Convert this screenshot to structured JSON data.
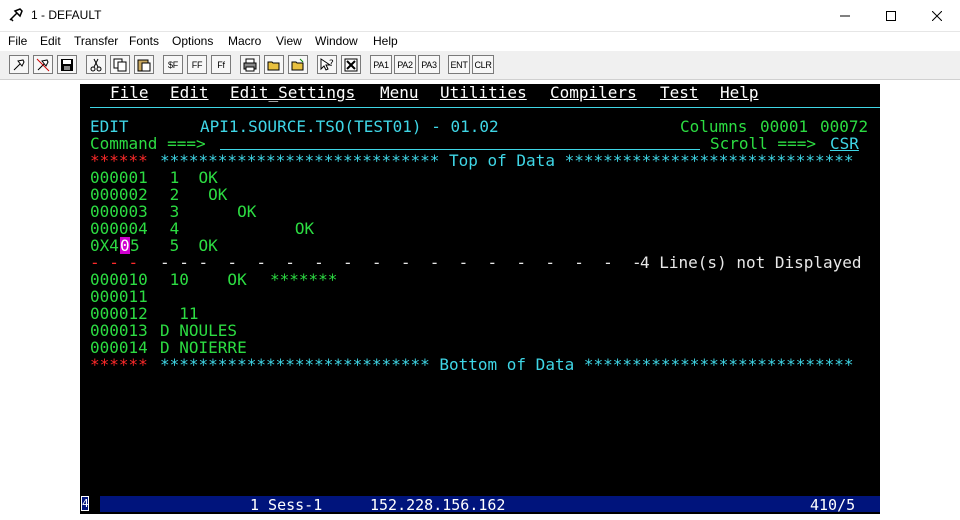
{
  "window": {
    "title": "1 - DEFAULT"
  },
  "menubar": {
    "items": [
      "File",
      "Edit",
      "Transfer",
      "Fonts",
      "Options",
      "Macro",
      "View",
      "Window",
      "Help"
    ]
  },
  "toolbar": {
    "pa1": "PA1",
    "pa2": "PA2",
    "pa3": "PA3",
    "ent": "ENT",
    "clr": "CLR"
  },
  "ispf": {
    "menu": [
      "File",
      "Edit",
      "Edit_Settings",
      "Menu",
      "Utilities",
      "Compilers",
      "Test",
      "Help"
    ],
    "header": {
      "mode": "EDIT",
      "dataset": "API1.SOURCE.TSO(TEST01) - 01.02",
      "columns_label": "Columns",
      "col_start": "00001",
      "col_end": "00072",
      "command_label": "Command ===>",
      "scroll_label": "Scroll ===>",
      "scroll_value": "CSR"
    },
    "top_marker": "******",
    "top_text": "***************************** Top of Data ******************************",
    "lines": [
      {
        "num": "000001",
        "text": " 1  OK"
      },
      {
        "num": "000002",
        "text": " 2   OK"
      },
      {
        "num": "000003",
        "text": " 3      OK"
      },
      {
        "num": "000004",
        "text": " 4            OK"
      },
      {
        "num_pre": "0X4",
        "num_cursor": "0",
        "num_post": "5",
        "text": " 5  OK"
      }
    ],
    "excluded_dashes": "- - -  -  -  -  -  -  -  -  -  -  -  -  -  -  -  -",
    "excluded_text": "4 Line(s) not Displayed",
    "lines2": [
      {
        "num": "000010",
        "text": " 10    OK",
        "stars": "*******"
      },
      {
        "num": "000011",
        "text": ""
      },
      {
        "num": "000012",
        "text": "  11"
      },
      {
        "num": "000013",
        "text": "D NOULES"
      },
      {
        "num": "000014",
        "text": "D NOIERRE"
      }
    ],
    "bottom_marker": "******",
    "bottom_text": "**************************** Bottom of Data ****************************"
  },
  "status": {
    "box": "4",
    "session": "1 Sess-1",
    "host": "152.228.156.162",
    "position": "410/5"
  }
}
